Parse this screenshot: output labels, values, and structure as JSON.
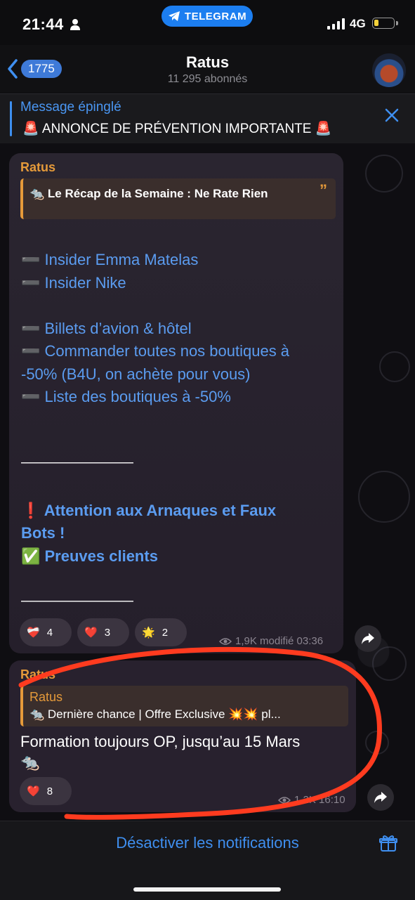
{
  "status_bar": {
    "time": "21:44",
    "app_pill": "TELEGRAM",
    "network": "4G",
    "battery_level": 0.25
  },
  "header": {
    "back_count": "1775",
    "title": "Ratus",
    "subtitle": "11 295 abonnés"
  },
  "pinned": {
    "label": "Message épinglé",
    "text": "🚨 ANNONCE DE PRÉVENTION IMPORTANTE 🚨"
  },
  "message1": {
    "sender": "Ratus",
    "quote": "🐀 Le Récap de la Semaine : Ne Rate Rien",
    "links": [
      "➖ Insider Emma Matelas",
      "➖ Insider Nike",
      "➖ Billets d’avion & hôtel",
      "➖ Commander toutes nos boutiques à",
      "-50% (B4U, on achète pour vous)",
      "➖ Liste des boutiques à -50%"
    ],
    "separator": "————————",
    "warning_line1": "❗ Attention aux Arnaques et Faux",
    "warning_line2": "Bots !",
    "proofs": "✅ Preuves clients",
    "reactions": [
      {
        "emoji": "❤️‍🩹",
        "count": "4"
      },
      {
        "emoji": "❤️",
        "count": "3"
      },
      {
        "emoji": "🌟",
        "count": "2"
      }
    ],
    "meta": "1,9K modifié 03:36"
  },
  "message2": {
    "sender": "Ratus",
    "quote_sender": "Ratus",
    "quote_text": "🐀 Dernière chance | Offre Exclusive 💥💥 pl...",
    "body_line1": "Formation toujours OP, jusqu’au 15 Mars",
    "body_line2": "🐀",
    "reactions": [
      {
        "emoji": "❤️",
        "count": "8"
      }
    ],
    "meta": "1,2K 16:10"
  },
  "bottom": {
    "mute_label": "Désactiver les notifications"
  },
  "colors": {
    "accent": "#3f8ff0",
    "sender": "#e59a3a",
    "annotation": "#ff3b1f"
  }
}
